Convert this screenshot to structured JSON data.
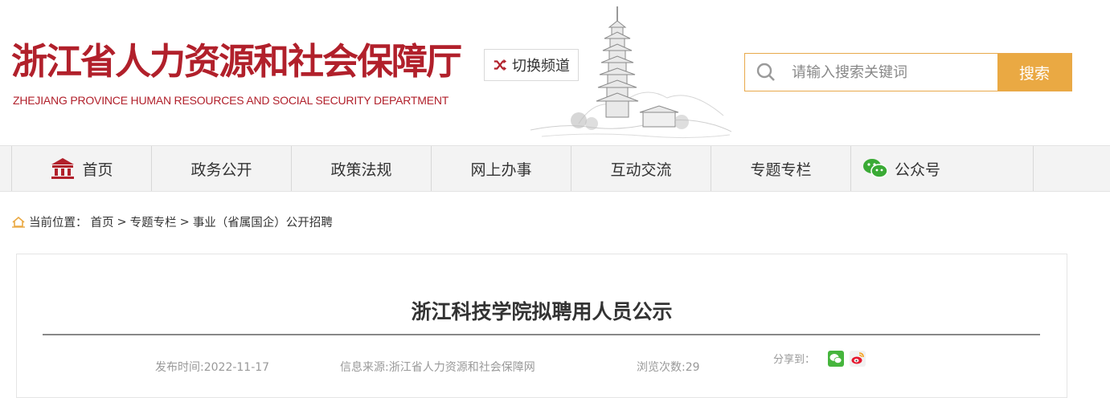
{
  "header": {
    "title": "浙江省人力资源和社会保障厅",
    "subtitle": "ZHEJIANG PROVINCE HUMAN RESOURCES AND SOCIAL SECURITY DEPARTMENT",
    "switch_label": "切换频道",
    "search_placeholder": "请输入搜索关键词",
    "search_button": "搜索"
  },
  "nav": {
    "items": [
      {
        "label": "首页",
        "icon": "bank-icon"
      },
      {
        "label": "政务公开"
      },
      {
        "label": "政策法规"
      },
      {
        "label": "网上办事"
      },
      {
        "label": "互动交流"
      },
      {
        "label": "专题专栏"
      },
      {
        "label": "公众号",
        "icon": "wechat-icon"
      }
    ]
  },
  "breadcrumb": {
    "prefix": "当前位置：",
    "items": [
      "首页",
      "专题专栏",
      "事业（省属国企）公开招聘"
    ],
    "separator": ">"
  },
  "article": {
    "title": "浙江科技学院拟聘用人员公示",
    "publish_time": "发布时间:2022-11-17",
    "source": "信息来源:浙江省人力资源和社会保障网",
    "views": "浏览次数:29",
    "share_label": "分享到："
  },
  "colors": {
    "brand_red": "#b1202b",
    "accent_orange": "#eaa943",
    "nav_bg": "#f3f3f3"
  }
}
